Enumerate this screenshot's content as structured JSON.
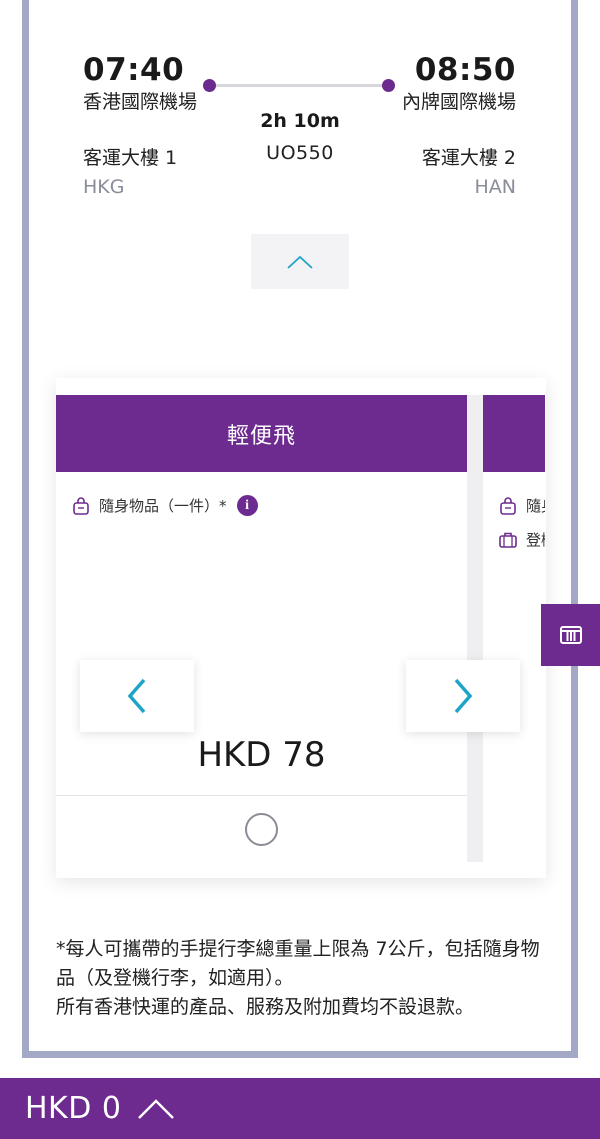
{
  "flight": {
    "departure": {
      "time": "07:40",
      "airport": "香港國際機場",
      "terminal": "客運大樓 1",
      "code": "HKG"
    },
    "arrival": {
      "time": "08:50",
      "airport": "內牌國際機場",
      "terminal": "客運大樓 2",
      "code": "HAN"
    },
    "duration": "2h 10m",
    "flight_number": "UO550"
  },
  "fare_card": {
    "title": "輕便飛",
    "items": [
      {
        "label": "隨身物品（一件）*"
      }
    ],
    "price": "HKD 78"
  },
  "fare_card_next": {
    "items": [
      {
        "label": "隨身物品"
      },
      {
        "label": "登機行李"
      }
    ]
  },
  "note": {
    "line1": "*每人可攜帶的手提行李總重量上限為 7公斤，包括隨身物品（及登機行李，如適用）。",
    "line2": "所有香港快運的產品、服務及附加費均不設退款。"
  },
  "bottom_bar": {
    "total": "HKD 0"
  },
  "colors": {
    "brand": "#6e2b8f",
    "accent_arrow": "#1fa4c8",
    "frame": "#a3a8c6"
  },
  "icons": [
    "chevron-up-icon",
    "bag-icon",
    "info-icon",
    "luggage-icon",
    "chevron-left-icon",
    "chevron-right-icon",
    "columns-icon"
  ]
}
